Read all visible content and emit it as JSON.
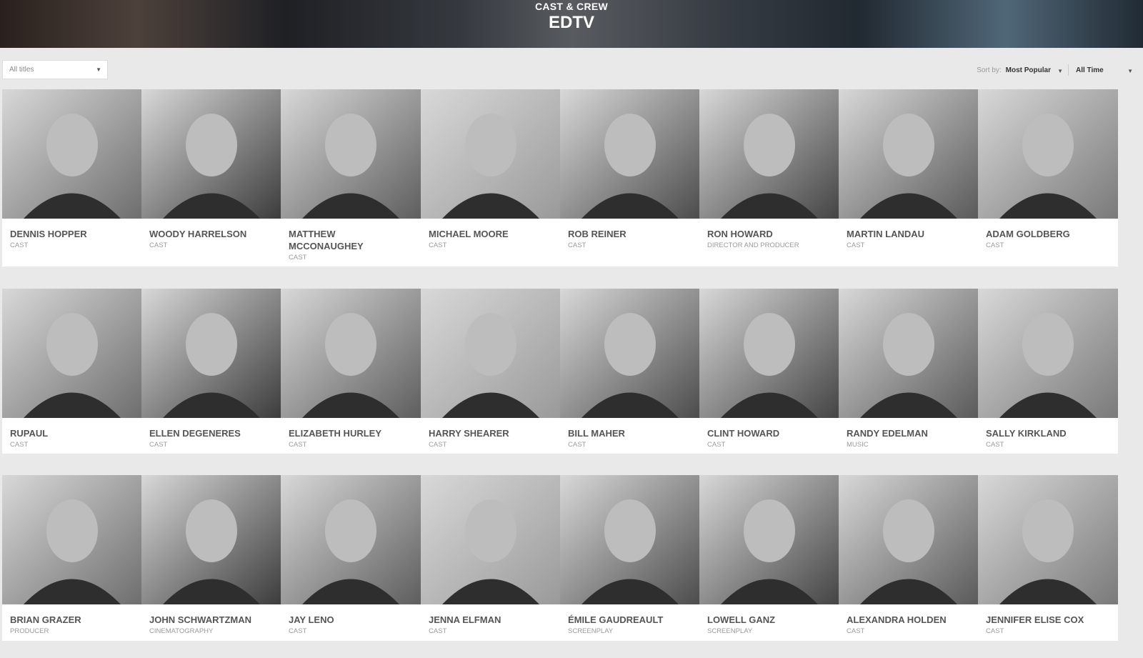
{
  "header": {
    "kicker": "CAST & CREW",
    "title": "EDTV"
  },
  "filter": {
    "value": "All titles"
  },
  "sort": {
    "label": "Sort by:",
    "value": "Most Popular",
    "time_value": "All Time"
  },
  "people": [
    {
      "name": "DENNIS HOPPER",
      "role": "CAST"
    },
    {
      "name": "WOODY HARRELSON",
      "role": "CAST"
    },
    {
      "name": "MATTHEW MCCONAUGHEY",
      "role": "CAST"
    },
    {
      "name": "MICHAEL MOORE",
      "role": "CAST"
    },
    {
      "name": "ROB REINER",
      "role": "CAST"
    },
    {
      "name": "RON HOWARD",
      "role": "DIRECTOR AND PRODUCER"
    },
    {
      "name": "MARTIN LANDAU",
      "role": "CAST"
    },
    {
      "name": "ADAM GOLDBERG",
      "role": "CAST"
    },
    {
      "name": "RUPAUL",
      "role": "CAST"
    },
    {
      "name": "ELLEN DEGENERES",
      "role": "CAST"
    },
    {
      "name": "ELIZABETH HURLEY",
      "role": "CAST"
    },
    {
      "name": "HARRY SHEARER",
      "role": "CAST"
    },
    {
      "name": "BILL MAHER",
      "role": "CAST"
    },
    {
      "name": "CLINT HOWARD",
      "role": "CAST"
    },
    {
      "name": "RANDY EDELMAN",
      "role": "MUSIC"
    },
    {
      "name": "SALLY KIRKLAND",
      "role": "CAST"
    },
    {
      "name": "BRIAN GRAZER",
      "role": "PRODUCER"
    },
    {
      "name": "JOHN SCHWARTZMAN",
      "role": "CINEMATOGRAPHY"
    },
    {
      "name": "JAY LENO",
      "role": "CAST"
    },
    {
      "name": "JENNA ELFMAN",
      "role": "CAST"
    },
    {
      "name": "ÉMILE GAUDREAULT",
      "role": "SCREENPLAY"
    },
    {
      "name": "LOWELL GANZ",
      "role": "SCREENPLAY"
    },
    {
      "name": "ALEXANDRA HOLDEN",
      "role": "CAST"
    },
    {
      "name": "JENNIFER ELISE COX",
      "role": "CAST"
    }
  ],
  "icons": {
    "dropdown_caret": "chevron-down-icon"
  }
}
